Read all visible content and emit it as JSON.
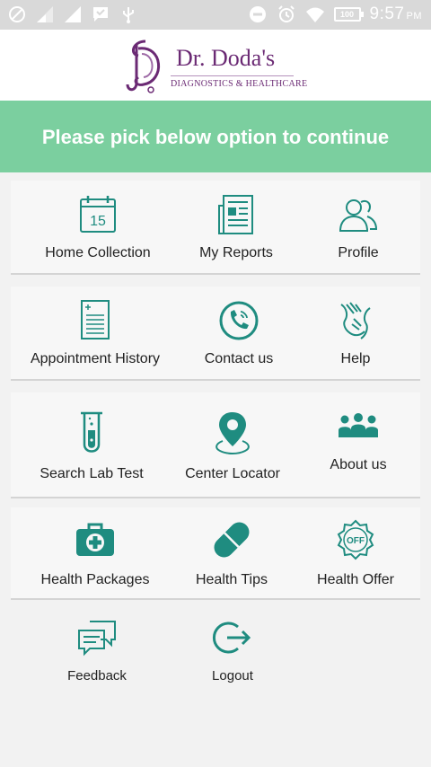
{
  "status_bar": {
    "time": "9:57",
    "ampm": "PM",
    "battery": "100"
  },
  "header": {
    "logo_title": "Dr. Doda's",
    "logo_subtitle": "DIAGNOSTICS & HEALTHCARE"
  },
  "banner": {
    "text": "Please pick below option to continue"
  },
  "menu": {
    "home_collection": "Home Collection",
    "my_reports": "My Reports",
    "profile": "Profile",
    "appointment_history": "Appointment History",
    "contact_us": "Contact us",
    "help": "Help",
    "search_lab_test": "Search Lab Test",
    "center_locator": "Center Locator",
    "about_us": "About us",
    "health_packages": "Health Packages",
    "health_tips": "Health Tips",
    "health_offer": "Health Offer",
    "feedback": "Feedback",
    "logout": "Logout"
  },
  "icons": {
    "calendar_day": "15",
    "offer_badge": "OFF"
  },
  "colors": {
    "accent": "#1f8c80",
    "banner": "#7bcf9f",
    "brand": "#6b2a74"
  }
}
